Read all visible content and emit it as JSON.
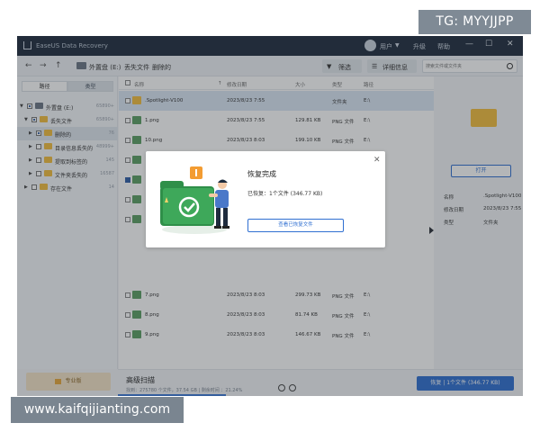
{
  "overlays": {
    "tg_tag": "TG: MYYJJPP",
    "watermark": "www.kaifqijianting.com"
  },
  "titlebar": {
    "app_title": "EaseUS Data Recovery",
    "username": "用户",
    "links": [
      "升级",
      "帮助"
    ],
    "window_buttons": [
      "—",
      "☐",
      "✕"
    ]
  },
  "toolbar": {
    "breadcrumb": [
      "外置盘 (E:)",
      "丢失文件",
      "删除的"
    ],
    "filter_label": "筛选",
    "detail_label": "详细信息",
    "search_placeholder": "搜索文件或文件夹"
  },
  "sidebar": {
    "tabs": [
      "路径",
      "类型"
    ],
    "tree": [
      {
        "label": "外置盘 (E:)",
        "count": "65890+"
      },
      {
        "label": "丢失文件",
        "count": "65890+"
      },
      {
        "label": "删除的",
        "count": "76"
      },
      {
        "label": "目录信息丢失的",
        "count": "48999+"
      },
      {
        "label": "提取到标签的",
        "count": "145"
      },
      {
        "label": "文件夹丢失的",
        "count": "16587"
      },
      {
        "label": "存在文件",
        "count": "14"
      }
    ],
    "pro_label": "专业版"
  },
  "filelist": {
    "columns": [
      "名称",
      "修改日期",
      "大小",
      "类型",
      "路径"
    ],
    "rows": [
      {
        "name": ".Spotlight-V100",
        "date": "2023/8/23 7:55",
        "size": "",
        "type": "文件夹",
        "path": "E:\\",
        "icon": "folder"
      },
      {
        "name": "1.png",
        "date": "2023/8/23 7:55",
        "size": "129.81 KB",
        "type": "PNG 文件",
        "path": "E:\\",
        "icon": "image"
      },
      {
        "name": "10.png",
        "date": "2023/8/23 8:03",
        "size": "199.10 KB",
        "type": "PNG 文件",
        "path": "E:\\",
        "icon": "image"
      },
      {
        "name": "",
        "date": "",
        "size": "",
        "type": "",
        "path": "",
        "icon": "image"
      },
      {
        "name": "",
        "date": "",
        "size": "",
        "type": "",
        "path": "",
        "icon": "image"
      },
      {
        "name": "",
        "date": "",
        "size": "",
        "type": "",
        "path": "",
        "icon": "image"
      },
      {
        "name": "",
        "date": "",
        "size": "",
        "type": "",
        "path": "",
        "icon": "image"
      },
      {
        "name": "7.png",
        "date": "2023/8/23 8:03",
        "size": "299.73 KB",
        "type": "PNG 文件",
        "path": "E:\\",
        "icon": "image"
      },
      {
        "name": "8.png",
        "date": "2023/8/23 8:03",
        "size": "81.74 KB",
        "type": "PNG 文件",
        "path": "E:\\",
        "icon": "image"
      },
      {
        "name": "9.png",
        "date": "2023/8/23 8:03",
        "size": "146.67 KB",
        "type": "PNG 文件",
        "path": "E:\\",
        "icon": "image"
      }
    ]
  },
  "detail": {
    "open_label": "打开",
    "fields": [
      {
        "key": "名称",
        "value": ".Spotlight-V100"
      },
      {
        "key": "修改日期",
        "value": "2023/8/23 7:55"
      },
      {
        "key": "类型",
        "value": "文件夹"
      }
    ]
  },
  "bottombar": {
    "scan_title": "高级扫描",
    "scan_status": "找到：275780 个文件，37.54 GB | 剩余时间 ：21.24%",
    "recover_label": "恢复 | 1个文件 (346.77 KB)"
  },
  "dialog": {
    "title": "恢复完成",
    "recovered_text": "已恢复：1个文件 (346.77 KB)",
    "view_button": "查看已恢复文件"
  },
  "colors": {
    "titlebar": "#1f2c3e",
    "accent": "#2f6fd1",
    "folder": "#f3bd3c",
    "illustration_green": "#3ea85a"
  }
}
